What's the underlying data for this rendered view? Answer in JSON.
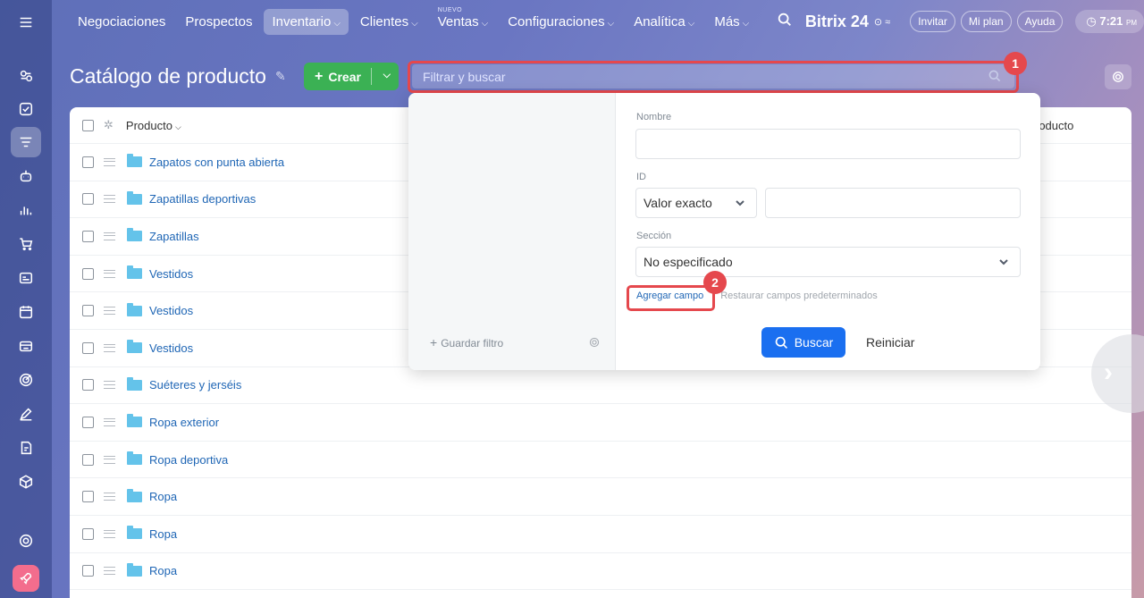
{
  "nav": {
    "items": [
      {
        "label": "Negociaciones",
        "chevron": false,
        "active": false
      },
      {
        "label": "Prospectos",
        "chevron": false,
        "active": false
      },
      {
        "label": "Inventario",
        "chevron": true,
        "active": true
      },
      {
        "label": "Clientes",
        "chevron": true,
        "active": false
      },
      {
        "label": "Ventas",
        "chevron": true,
        "active": false,
        "badge": "NUEVO"
      },
      {
        "label": "Configuraciones",
        "chevron": true,
        "active": false
      },
      {
        "label": "Analítica",
        "chevron": true,
        "active": false
      },
      {
        "label": "Más",
        "chevron": true,
        "active": false
      }
    ],
    "brand": "Bitrix 24",
    "invite": "Invitar",
    "my_plan": "Mi plan",
    "help": "Ayuda",
    "time": "7:21",
    "time_suffix": "PM"
  },
  "page": {
    "title": "Catálogo de producto",
    "create_label": "Crear"
  },
  "filter": {
    "placeholder": "Filtrar y buscar",
    "callout": "1"
  },
  "popup": {
    "save_filter": "Guardar filtro",
    "fields": {
      "name_label": "Nombre",
      "name_value": "",
      "id_label": "ID",
      "id_mode": "Valor exacto",
      "id_value": "",
      "section_label": "Sección",
      "section_value": "No especificado"
    },
    "add_field": "Agregar campo",
    "restore_fields": "Restaurar campos predeterminados",
    "add_callout": "2",
    "search_button": "Buscar",
    "reset_button": "Reiniciar"
  },
  "grid": {
    "column_product": "Producto",
    "column_right": "roducto",
    "rows": [
      "Zapatos con punta abierta",
      "Zapatillas deportivas",
      "Zapatillas",
      "Vestidos",
      "Vestidos",
      "Vestidos",
      "Suéteres y jerséis",
      "Ropa exterior",
      "Ropa deportiva",
      "Ropa",
      "Ropa",
      "Ropa"
    ]
  },
  "colors": {
    "accent": "#1a6ff0",
    "create": "#3bb154",
    "highlight": "#e5484d",
    "link": "#1f66b5"
  }
}
